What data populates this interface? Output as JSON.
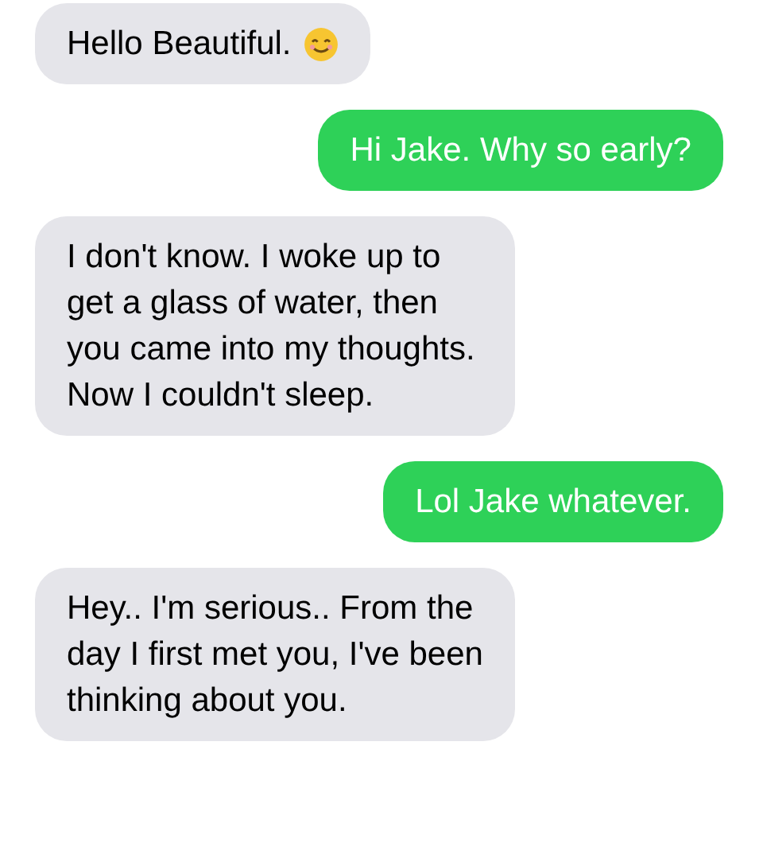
{
  "messages": [
    {
      "kind": "received",
      "text": "Hello Beautiful.",
      "emoji": true
    },
    {
      "kind": "sent",
      "text": "Hi Jake. Why so early?",
      "emoji": false
    },
    {
      "kind": "received",
      "text": "I don't know. I woke up to get a glass of water, then you came into my thoughts. Now I couldn't sleep.",
      "emoji": false
    },
    {
      "kind": "sent",
      "text": "Lol Jake whatever.",
      "emoji": false
    },
    {
      "kind": "received",
      "text": "Hey.. I'm serious.. From the day I first met you, I've been thinking about you.",
      "emoji": false
    }
  ]
}
